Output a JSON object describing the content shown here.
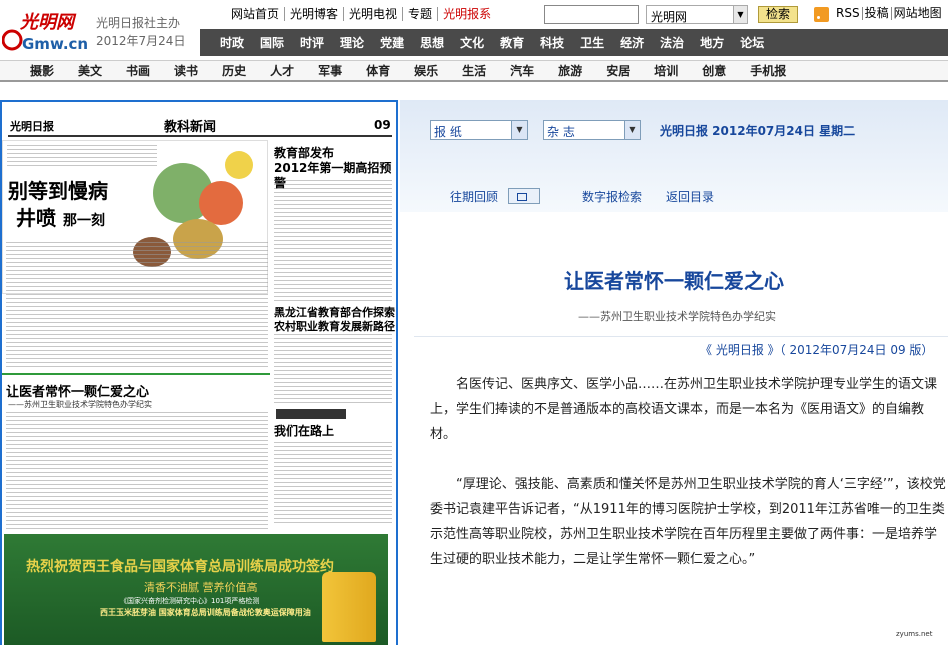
{
  "header": {
    "logo_text": "光明网",
    "logo_sub": "Gmw.cn",
    "org": "光明日报社主办",
    "date": "2012年7月24日",
    "top_links": [
      "网站首页",
      "光明博客",
      "光明电视",
      "专题",
      "光明报系"
    ],
    "search_placeholder": "",
    "site_select": "光明网",
    "search_button": "检索",
    "rss": "RSS",
    "util_links": [
      "投稿",
      "网站地图"
    ],
    "main_nav": [
      "时政",
      "国际",
      "时评",
      "理论",
      "党建",
      "思想",
      "文化",
      "教育",
      "科技",
      "卫生",
      "经济",
      "法治",
      "地方",
      "论坛"
    ],
    "sub_nav": [
      "摄影",
      "美文",
      "书画",
      "读书",
      "历史",
      "人才",
      "军事",
      "体育",
      "娱乐",
      "生活",
      "汽车",
      "旅游",
      "安居",
      "培训",
      "创意",
      "手机报"
    ]
  },
  "newspaper": {
    "masthead": "光明日报",
    "section": "教科新闻",
    "page_no": "09",
    "headline_a": "别等到慢病",
    "headline_b1": "井喷",
    "headline_b2": "那一刻",
    "h2": "教育部发布\n2012年第一期高招预警",
    "h3": "黑龙江省教育部合作探索\n农村职业教育发展新路径",
    "h4": "让医者常怀一颗仁爱之心",
    "h4_sub": "——苏州卫生职业技术学院特色办学纪实",
    "h5": "我们在路上",
    "ad_line1": "热烈祝贺西王食品与国家体育总局训练局成功签约",
    "ad_line2": "清香不油腻 营养价值高",
    "ad_line3": "《国家兴奋剂检测研究中心》101项严格检测",
    "ad_line4": "西王玉米胚芽油 国家体育总局训练局备战伦敦奥运保障用油"
  },
  "toolbar": {
    "select_newspaper": "报 纸",
    "select_magazine": "杂 志",
    "current_date": "光明日报 2012年07月24日 星期二",
    "link_past": "往期回顾",
    "link_digital": "数字报检索",
    "link_back": "返回目录"
  },
  "article": {
    "title": "让医者常怀一颗仁爱之心",
    "subtitle": "——苏州卫生职业技术学院特色办学纪实",
    "meta": "《 光明日报 》（ 2012年07月24日   09 版）",
    "paragraphs": [
      "名医传记、医典序文、医学小品……在苏州卫生职业技术学院护理专业学生的语文课上，学生们捧读的不是普通版本的高校语文课本，而是一本名为《医用语文》的自编教材。",
      "“厚理论、强技能、高素质和懂关怀是苏州卫生职业技术学院的育人‘三字经’”，该校党委书记袁建平告诉记者，“从1911年的博习医院护士学校，到2011年江苏省唯一的卫生类示范性高等职业院校，苏州卫生职业技术学院在百年历程里主要做了两件事：一是培养学生过硬的职业技术能力，二是让学生常怀一颗仁爱之心。”"
    ]
  },
  "watermark": "zyums.net"
}
